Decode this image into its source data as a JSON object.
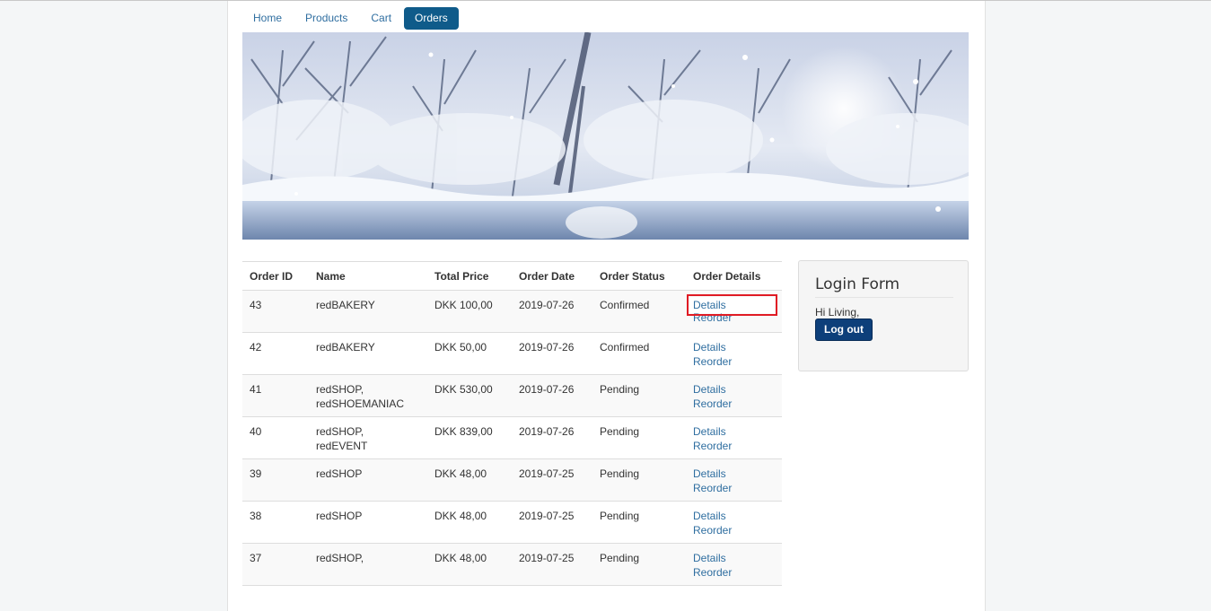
{
  "nav": {
    "items": [
      "Home",
      "Products",
      "Cart",
      "Orders"
    ],
    "active": "Orders"
  },
  "table": {
    "headers": [
      "Order ID",
      "Name",
      "Total Price",
      "Order Date",
      "Order Status",
      "Order Details"
    ],
    "rows": [
      {
        "id": "43",
        "name": [
          "redBAKERY"
        ],
        "price": "DKK 100,00",
        "date": "2019-07-26",
        "status": "Confirmed",
        "details": "Details",
        "reorder": "Reorder"
      },
      {
        "id": "42",
        "name": [
          "redBAKERY"
        ],
        "price": "DKK 50,00",
        "date": "2019-07-26",
        "status": "Confirmed",
        "details": "Details",
        "reorder": "Reorder"
      },
      {
        "id": "41",
        "name": [
          "redSHOP,",
          "redSHOEMANIAC"
        ],
        "price": "DKK 530,00",
        "date": "2019-07-26",
        "status": "Pending",
        "details": "Details",
        "reorder": "Reorder"
      },
      {
        "id": "40",
        "name": [
          "redSHOP,",
          "redEVENT"
        ],
        "price": "DKK 839,00",
        "date": "2019-07-26",
        "status": "Pending",
        "details": "Details",
        "reorder": "Reorder"
      },
      {
        "id": "39",
        "name": [
          "redSHOP"
        ],
        "price": "DKK 48,00",
        "date": "2019-07-25",
        "status": "Pending",
        "details": "Details",
        "reorder": "Reorder"
      },
      {
        "id": "38",
        "name": [
          "redSHOP"
        ],
        "price": "DKK 48,00",
        "date": "2019-07-25",
        "status": "Pending",
        "details": "Details",
        "reorder": "Reorder"
      },
      {
        "id": "37",
        "name": [
          "redSHOP,"
        ],
        "price": "DKK 48,00",
        "date": "2019-07-25",
        "status": "Pending",
        "details": "Details",
        "reorder": "Reorder"
      }
    ]
  },
  "login": {
    "title": "Login Form",
    "greeting": "Hi Living,",
    "logout_label": "Log out"
  },
  "colors": {
    "accent": "#0f5b8a",
    "link": "#2f6ea0",
    "button": "#0d3f7a",
    "highlight": "#e01b24"
  },
  "icons": {
    "banner": "snowy-winter-landscape-image"
  }
}
